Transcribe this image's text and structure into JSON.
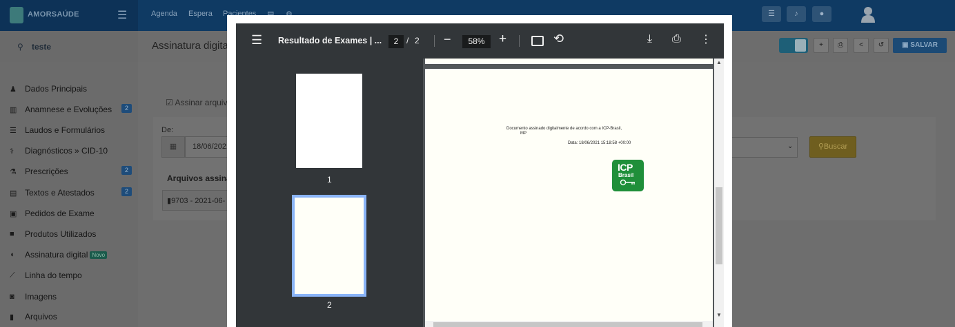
{
  "app": {
    "logo_text": "AMORSAÚDE",
    "nav": [
      "Agenda",
      "Espera",
      "Pacientes"
    ]
  },
  "sidebar": {
    "search_value": "teste",
    "items": [
      {
        "label": "Dados Principais",
        "icon": "user-icon"
      },
      {
        "label": "Anamnese e Evoluções",
        "icon": "chart-icon",
        "badge": "2"
      },
      {
        "label": "Laudos e Formulários",
        "icon": "list-icon"
      },
      {
        "label": "Diagnósticos » CID-10",
        "icon": "stethoscope-icon"
      },
      {
        "label": "Prescrições",
        "icon": "flask-icon",
        "badge": "2"
      },
      {
        "label": "Textos e Atestados",
        "icon": "file-text-icon",
        "badge": "2"
      },
      {
        "label": "Pedidos de Exame",
        "icon": "clipboard-icon"
      },
      {
        "label": "Produtos Utilizados",
        "icon": "briefcase-icon"
      },
      {
        "label": "Assinatura digital",
        "icon": "shield-icon",
        "tag": "Novo"
      },
      {
        "label": "Linha do tempo",
        "icon": "line-chart-icon"
      },
      {
        "label": "Imagens",
        "icon": "camera-icon"
      },
      {
        "label": "Arquivos",
        "icon": "file-icon"
      }
    ]
  },
  "main": {
    "page_title": "Assinatura digital",
    "save_label": "SALVAR",
    "sign_files_label": "Assinar arquivos",
    "from_label": "De:",
    "from_date": "18/06/2021",
    "files_heading": "Arquivos assinados",
    "file_item": "9703 - 2021-06-",
    "search_button": "Buscar"
  },
  "viewer": {
    "title": "Resultado de Exames | ...",
    "current_page": "2",
    "total_pages": "2",
    "page_separator": "/",
    "zoom": "58%",
    "thumbnails": [
      "1",
      "2"
    ],
    "page_text": {
      "line1": "Documento assinado digitalmente de acordo com a ICP-Brasil,",
      "line2": "MP",
      "line3": "Data: 18/06/2021 15:18:58 +00:00"
    },
    "icp_logo": {
      "line1": "ICP",
      "line2": "Brasil"
    }
  },
  "colors": {
    "icp_green": "#1f8f3a",
    "viewer_toolbar": "#323639",
    "thumb_selected": "#8ab4f8"
  }
}
